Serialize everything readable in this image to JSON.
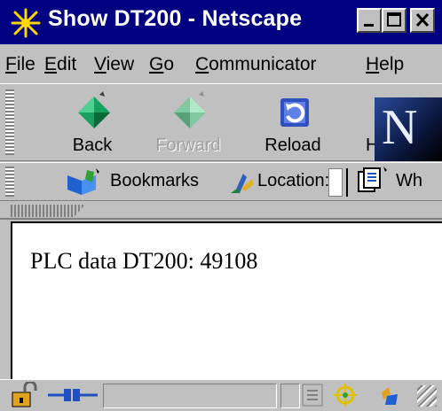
{
  "window": {
    "title": "Show DT200 - Netscape",
    "title_bar_color": "#000080"
  },
  "menu": {
    "items": [
      {
        "label": "File",
        "mnemonic": "F",
        "rest": "ile"
      },
      {
        "label": "Edit",
        "mnemonic": "E",
        "rest": "dit"
      },
      {
        "label": "View",
        "mnemonic": "V",
        "rest": "iew"
      },
      {
        "label": "Go",
        "mnemonic": "G",
        "rest": "o"
      },
      {
        "label": "Communicator",
        "mnemonic": "C",
        "rest": "ommunicator"
      },
      {
        "label": "Help",
        "mnemonic": "H",
        "rest": "elp"
      }
    ]
  },
  "toolbar": {
    "back_label": "Back",
    "forward_label": "Forward",
    "reload_label": "Reload",
    "home_label_partial": "H",
    "logo_letter": "N"
  },
  "location_bar": {
    "bookmarks_label": "Bookmarks",
    "location_label": "Location:",
    "whats_related_partial": "Wh"
  },
  "content": {
    "text": "PLC data DT200: 49108"
  },
  "icons": {
    "app": "netscape-sparkle-icon",
    "back": "back-arrow-icon",
    "forward": "forward-arrow-icon",
    "reload": "reload-icon",
    "bookmarks": "bookmarks-icon",
    "location": "location-icon",
    "related": "whats-related-icon",
    "security": "lock-icon",
    "connection": "connection-plug-icon"
  }
}
